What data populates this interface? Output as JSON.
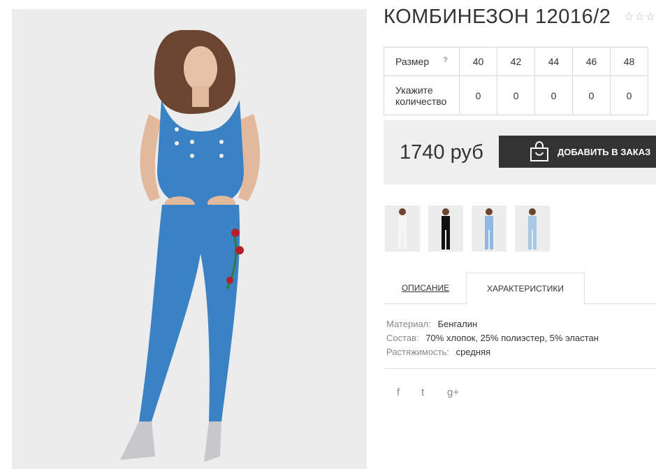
{
  "product": {
    "title": "КОМБИНЕЗОН 12016/2",
    "stars": "☆☆☆"
  },
  "sizes": {
    "row_label": "Размер",
    "help_symbol": "?",
    "qty_label_line1": "Укажите",
    "qty_label_line2": "количество",
    "columns": [
      {
        "size": "40",
        "qty": "0"
      },
      {
        "size": "42",
        "qty": "0"
      },
      {
        "size": "44",
        "qty": "0"
      },
      {
        "size": "46",
        "qty": "0"
      },
      {
        "size": "48",
        "qty": "0"
      }
    ]
  },
  "price": "1740 руб",
  "order_button": "ДОБАВИТЬ В ЗАКАЗ",
  "thumbnails": [
    {
      "outfit": "white"
    },
    {
      "outfit": "black"
    },
    {
      "outfit": "light-blue"
    },
    {
      "outfit": "light-blue"
    }
  ],
  "tabs": {
    "description": "ОПИСАНИЕ",
    "characteristics": "ХАРАКТЕРИСТИКИ",
    "active": "characteristics"
  },
  "characteristics": [
    {
      "key": "Материал:",
      "value": "Бенгалин"
    },
    {
      "key": "Состав:",
      "value": "70% хлопок, 25% полиэстер, 5% эластан"
    },
    {
      "key": "Растяжимость:",
      "value": "средняя"
    }
  ],
  "social": {
    "facebook": "f",
    "twitter": "t",
    "google_plus": "g+"
  },
  "colors": {
    "dark": "#333333",
    "panel": "#efefef",
    "denim": "#3a82c4"
  }
}
